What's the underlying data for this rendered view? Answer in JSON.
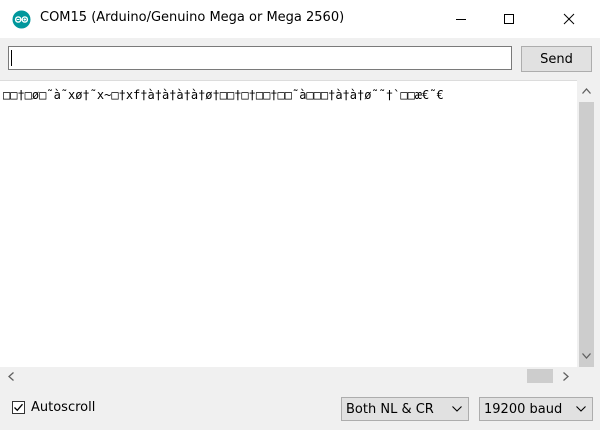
{
  "window": {
    "title": "COM15 (Arduino/Genuino Mega or Mega 2560)",
    "accent": "#00979c"
  },
  "input": {
    "value": "",
    "send_label": "Send"
  },
  "output": {
    "text": "□□†□ø□˜à˜xø†˜x~□†xf†à†à†à†à†ø†□□†□†□□†□□˜à□□□†à†à†ø˜˜†`□□æ€˜€"
  },
  "footer": {
    "autoscroll_label": "Autoscroll",
    "autoscroll_checked": true,
    "line_ending": "Both NL & CR",
    "baud_rate": "19200 baud"
  }
}
